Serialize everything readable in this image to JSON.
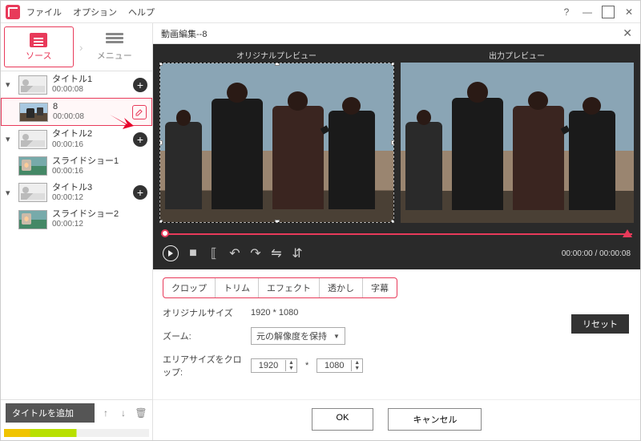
{
  "menubar": {
    "file": "ファイル",
    "option": "オプション",
    "help": "ヘルプ"
  },
  "window": {
    "tooltip": "?"
  },
  "modes": {
    "source": "ソース",
    "menu": "メニュー"
  },
  "items": [
    {
      "name": "タイトル1",
      "dur": "00:00:08",
      "thumb": "ph"
    },
    {
      "name": "8",
      "dur": "00:00:08",
      "thumb": "beach",
      "selected": true
    },
    {
      "name": "タイトル2",
      "dur": "00:00:16",
      "thumb": "ph"
    },
    {
      "name": "スライドショー1",
      "dur": "00:00:16",
      "thumb": "slide"
    },
    {
      "name": "タイトル3",
      "dur": "00:00:12",
      "thumb": "ph"
    },
    {
      "name": "スライドショー2",
      "dur": "00:00:12",
      "thumb": "slide"
    }
  ],
  "sidebar": {
    "add_title": "タイトルを追加"
  },
  "editor": {
    "title": "動画編集--8",
    "preview_original": "オリジナルプレビュー",
    "preview_output": "出力プレビュー",
    "time": "00:00:00 / 00:00:08"
  },
  "tabs": {
    "crop": "クロップ",
    "trim": "トリム",
    "effect": "エフェクト",
    "watermark": "透かし",
    "subtitle": "字幕"
  },
  "form": {
    "orig_size_lbl": "オリジナルサイズ",
    "orig_size_val": "1920 * 1080",
    "zoom_lbl": "ズーム:",
    "zoom_val": "元の解像度を保持",
    "crop_lbl": "エリアサイズをクロップ:",
    "crop_w": "1920",
    "crop_star": "*",
    "crop_h": "1080",
    "reset": "リセット"
  },
  "dialog": {
    "ok": "OK",
    "cancel": "キャンセル"
  }
}
